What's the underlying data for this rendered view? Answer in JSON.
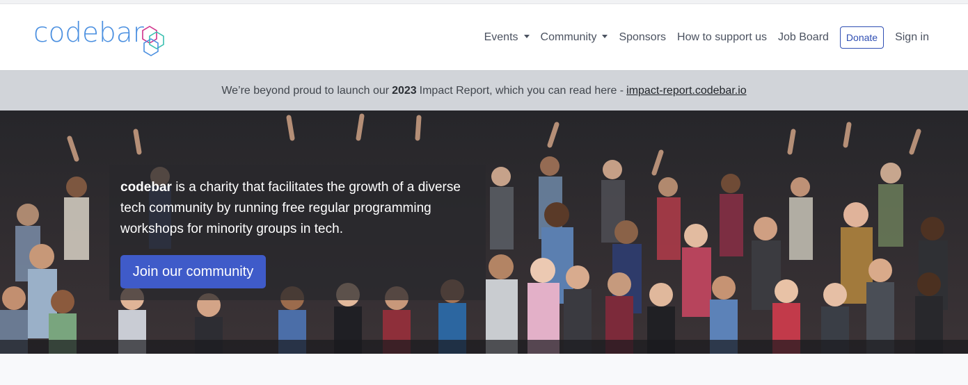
{
  "brand": {
    "name": "codebar"
  },
  "nav": {
    "events": "Events",
    "community": "Community",
    "sponsors": "Sponsors",
    "support": "How to support us",
    "jobs": "Job Board",
    "donate": "Donate",
    "signin": "Sign in"
  },
  "announcement": {
    "prefix": "We’re beyond proud to launch our",
    "year": "2023",
    "middle": "Impact Report, which you can read here -",
    "link": "impact-report.codebar.io"
  },
  "hero": {
    "brand_word": "codebar",
    "description": "is a charity that facilitates the growth of a diverse tech community by running free regular programming workshops for minority groups in tech.",
    "cta": "Join our community",
    "image": "group-photo-of-community"
  },
  "colors": {
    "brand_blue": "#4a8fe0",
    "button_blue": "#3f5bc9",
    "announce_bg": "#d1d4d9"
  }
}
